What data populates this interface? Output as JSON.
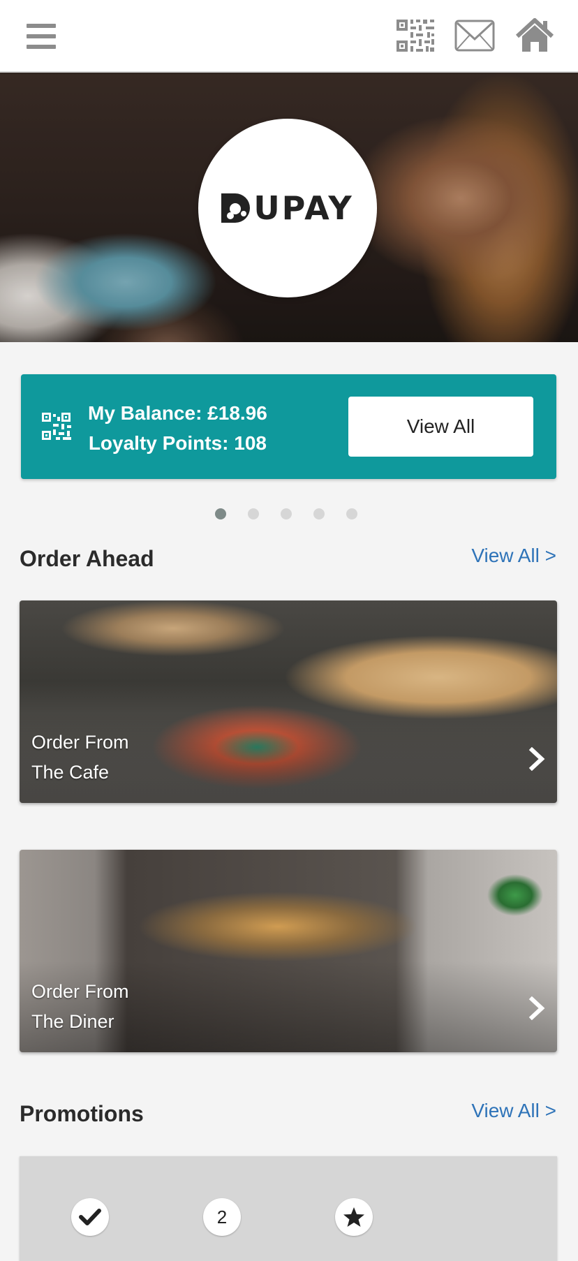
{
  "header": {
    "menu_icon": "hamburger-menu-icon",
    "qr_icon": "qr-code-icon",
    "mail_icon": "envelope-icon",
    "home_icon": "home-icon"
  },
  "hero": {
    "logo_text": "UPAY"
  },
  "balance": {
    "balance_line": "My Balance: £18.96",
    "points_line": "Loyalty Points: 108",
    "view_all_label": "View All",
    "accent_color": "#0f999c"
  },
  "carousel": {
    "dot_count": 5,
    "active_index": 0
  },
  "order_ahead": {
    "title": "Order Ahead",
    "link": "View All >",
    "cards": [
      {
        "line1": "Order From",
        "line2": "The Cafe"
      },
      {
        "line1": "Order From",
        "line2": "The Diner"
      }
    ]
  },
  "promotions": {
    "title": "Promotions",
    "link": "View All >",
    "badges": [
      "check-icon",
      "2",
      "star-icon"
    ]
  }
}
